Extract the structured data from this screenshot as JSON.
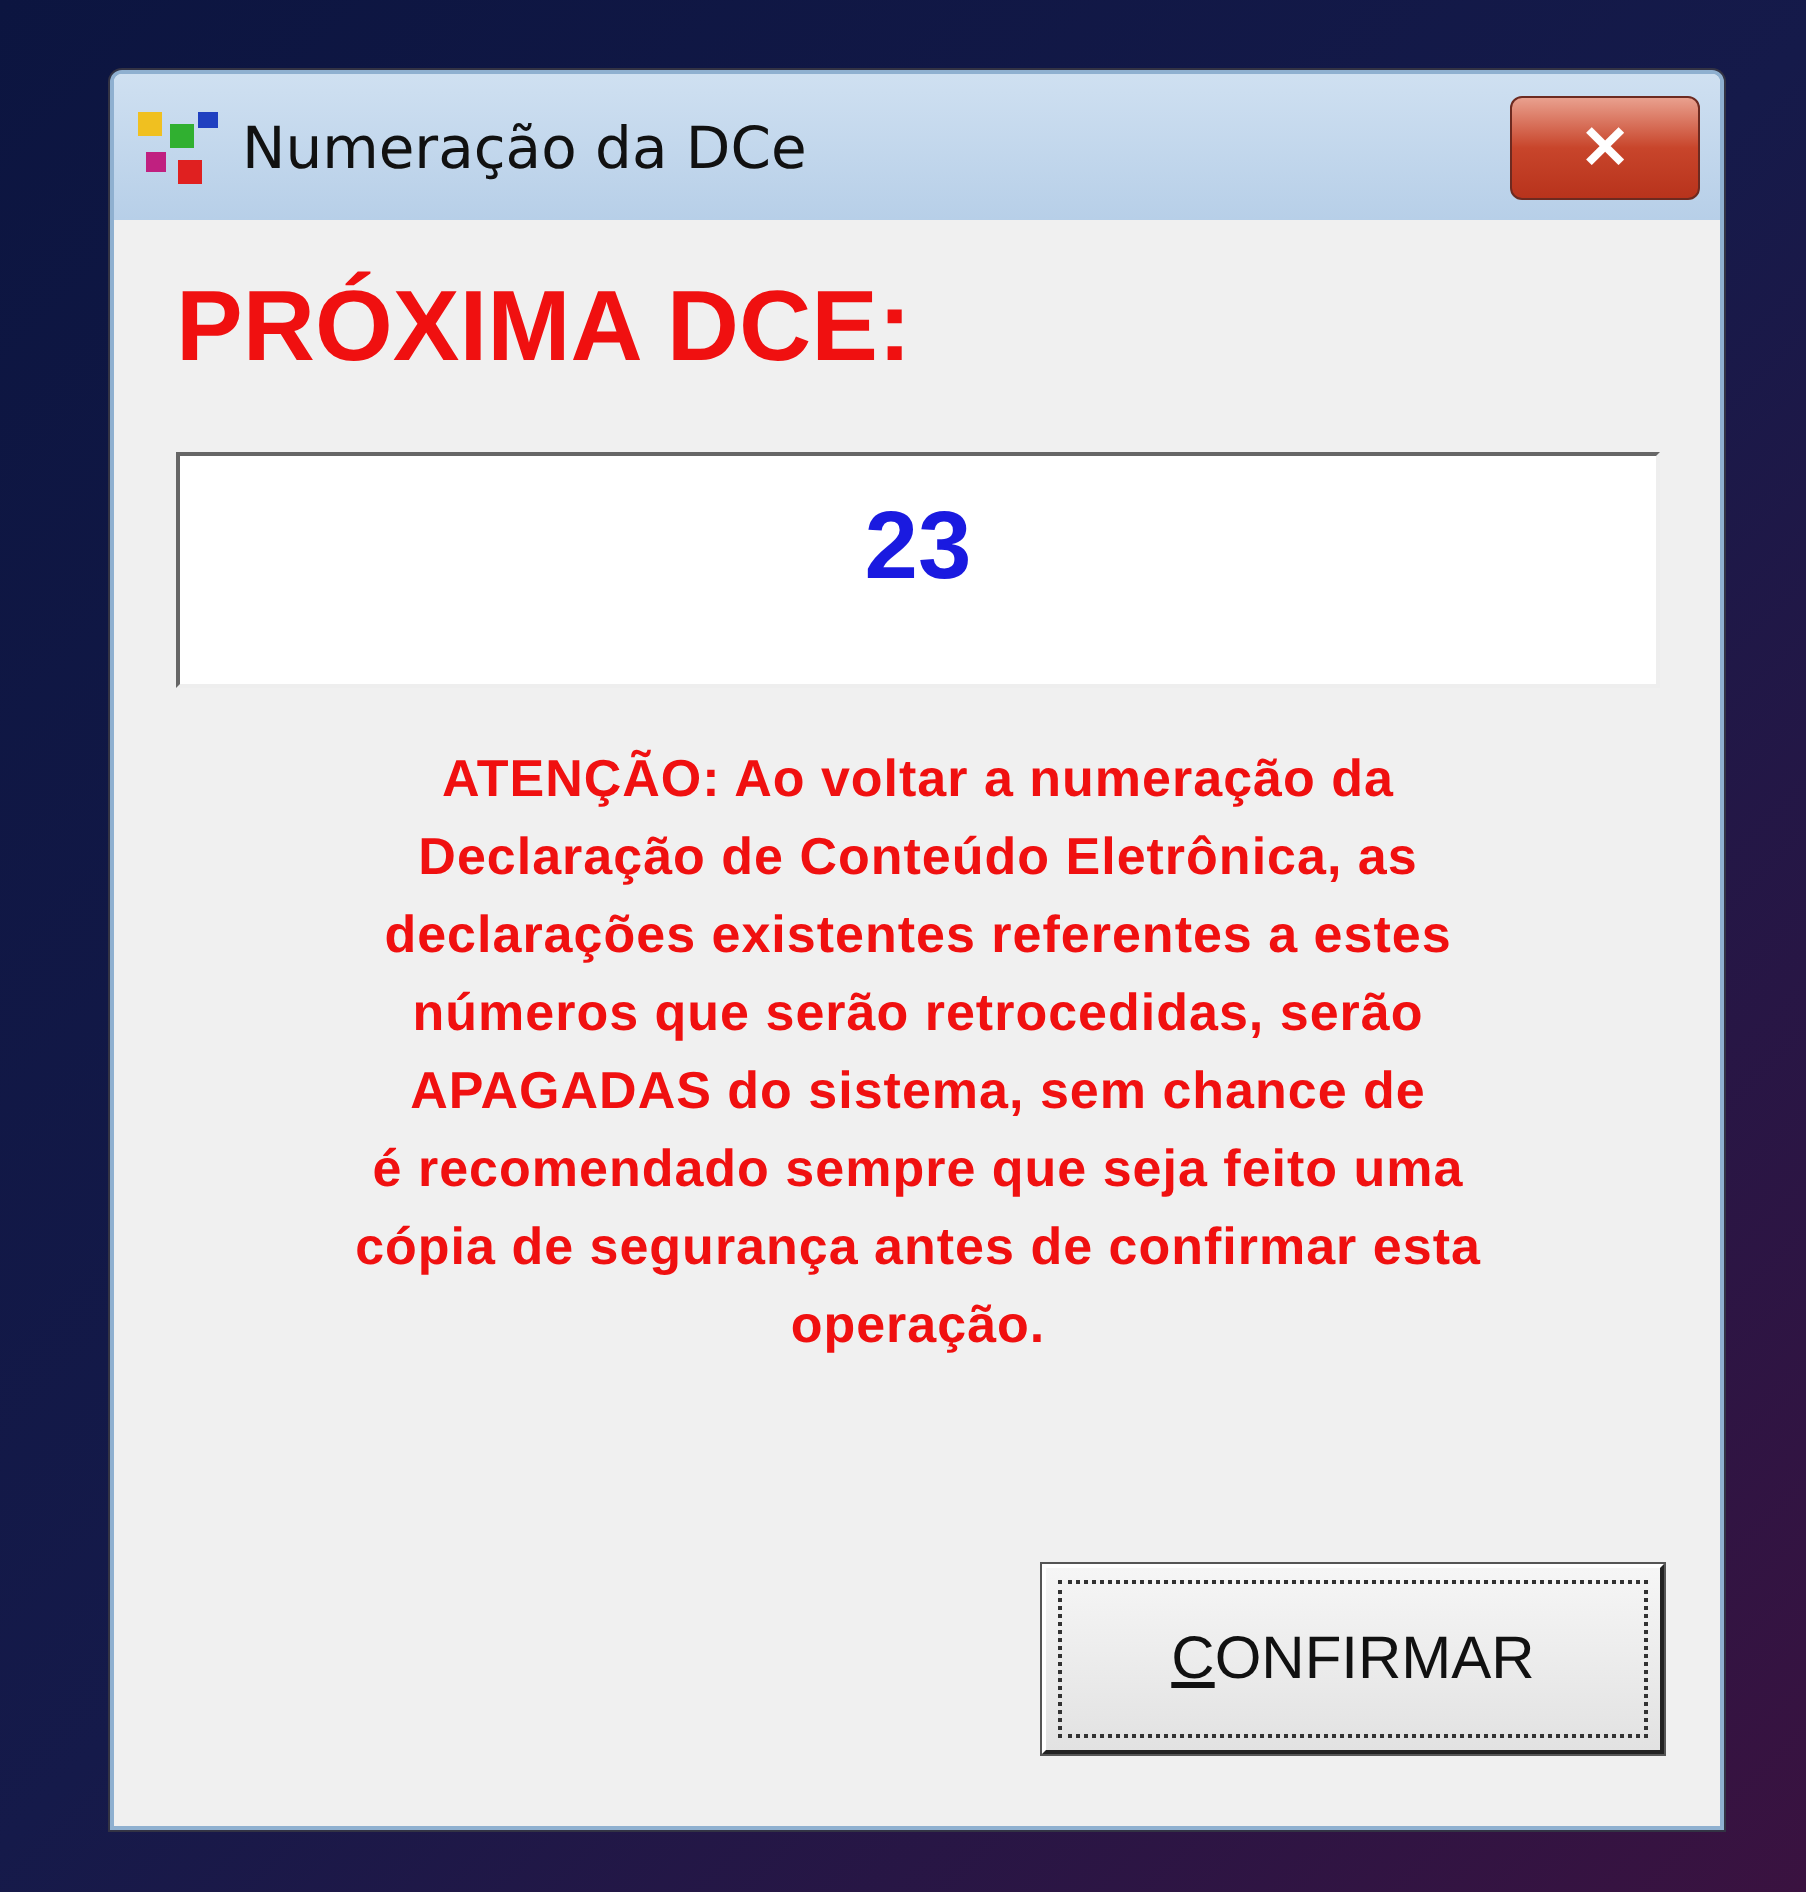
{
  "window": {
    "title": "Numeração da DCe",
    "close_label": "✕"
  },
  "heading": "PRÓXIMA DCE:",
  "number_field": {
    "value": "23"
  },
  "warning": "ATENÇÃO: Ao voltar a numeração da\nDeclaração de Conteúdo Eletrônica, as\ndeclarações existentes referentes a estes\nnúmeros que serão retrocedidas, serão\nAPAGADAS do sistema, sem chance de\n é recomendado sempre que seja feito uma\ncópia de segurança antes de confirmar esta\noperação.",
  "confirm_button": {
    "label": "CONFIRMAR",
    "access_key_underlined": true,
    "focused": true
  }
}
